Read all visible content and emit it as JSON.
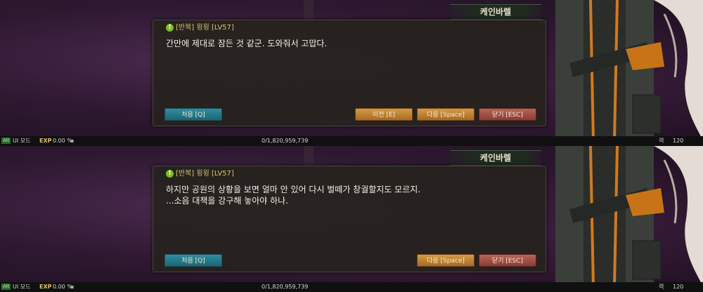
{
  "npc_name": "케인바렐",
  "quest_icon": "!",
  "quest_label": "[반복] 윙윙 [LV57]",
  "panels": [
    {
      "lines": [
        "간만에 제대로 잠든 것 같군. 도와줘서 고맙다."
      ],
      "buttons": {
        "first": "처음 [Q]",
        "prev": "이전 [E]",
        "next": "다음 [Space]",
        "close": "닫기 [ESC]"
      }
    },
    {
      "lines": [
        "하지만 공원의 상황을 보면 얼마 안 있어 다시 벌떼가 창궐할지도 모르지.",
        "...소음 대책을 강구해 놓아야 하나."
      ],
      "buttons": {
        "first": "처음 [Q]",
        "next": "다음 [Space]",
        "close": "닫기 [ESC]"
      }
    }
  ],
  "statusbar": {
    "alt": "Alt",
    "ui_mode": "UI 모드",
    "exp_label": "EXP",
    "exp_value": "0.00 %",
    "exp_total": "0/1,820,959,739",
    "right_glyph": "력",
    "right_value": "120"
  },
  "colors": {
    "quest_text": "#d9c36a",
    "button_teal": "#2f8ea0",
    "button_orange": "#d49a45",
    "button_red": "#b86458"
  }
}
